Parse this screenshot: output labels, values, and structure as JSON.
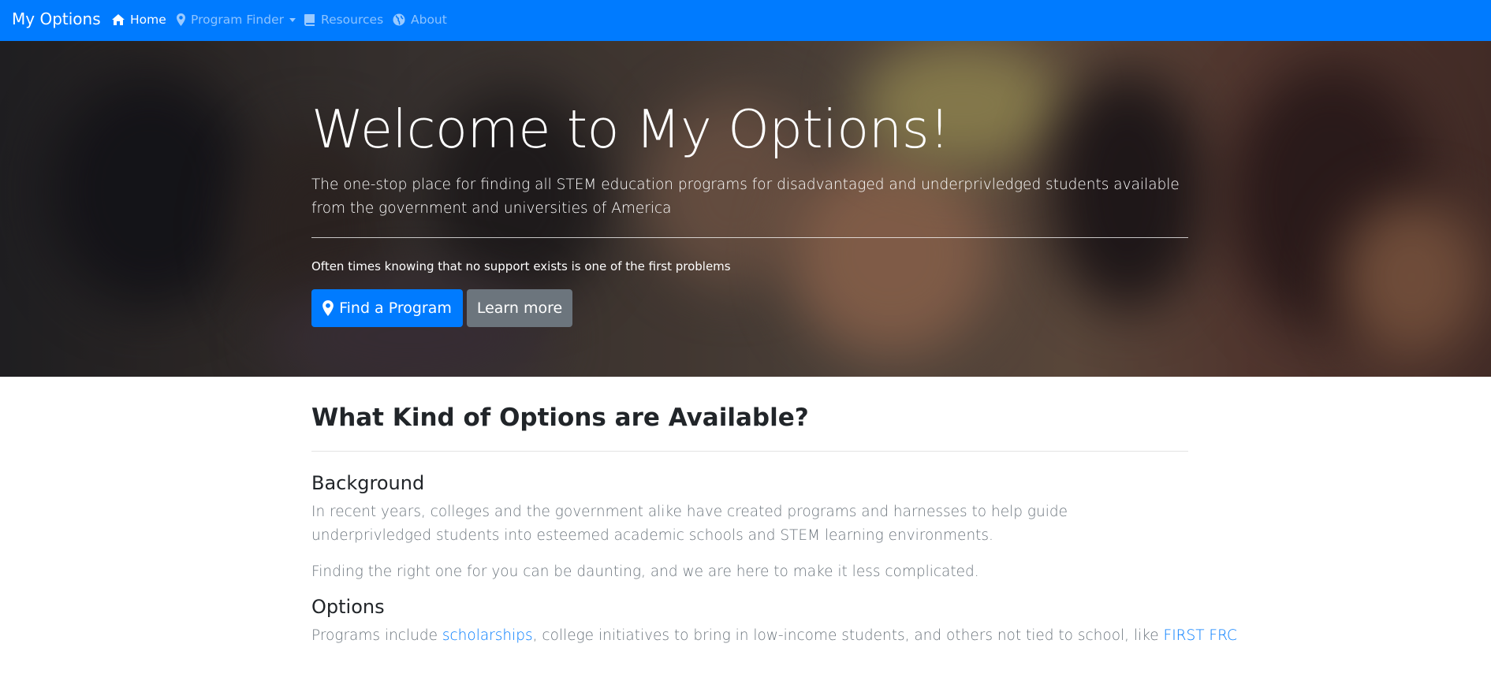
{
  "navbar": {
    "brand": "My Options",
    "items": [
      {
        "label": "Home",
        "icon": "home-icon",
        "active": true
      },
      {
        "label": "Program Finder",
        "icon": "map-pin-icon",
        "dropdown": true
      },
      {
        "label": "Resources",
        "icon": "book-icon"
      },
      {
        "label": "About",
        "icon": "globe-icon"
      }
    ],
    "bg_color": "#007bff"
  },
  "hero": {
    "title": "Welcome to My Options!",
    "lead": "The one-stop place for finding all STEM education programs for disadvantaged and underprivledged students available from the government and universities of America",
    "note": "Often times knowing that no support exists is one of the first problems",
    "primary_button": {
      "label": "Find a Program",
      "icon": "map-pin-icon",
      "color": "#007bff"
    },
    "secondary_button": {
      "label": "Learn more",
      "color": "#6c757d"
    }
  },
  "main": {
    "title": "What Kind of Options are Available?",
    "background": {
      "heading": "Background",
      "p1": "In recent years, colleges and the government alike have created programs and harnesses to help guide underprivledged students into esteemed academic schools and STEM learning environments.",
      "p2": "Finding the right one for you can be daunting, and we are here to make it less complicated."
    },
    "options": {
      "heading": "Options",
      "text_before": "Programs include ",
      "link1": "scholarships",
      "text_middle": ", college initiatives to bring in low-income students, and others not tied to school, like ",
      "link2": "FIRST FRC"
    }
  }
}
